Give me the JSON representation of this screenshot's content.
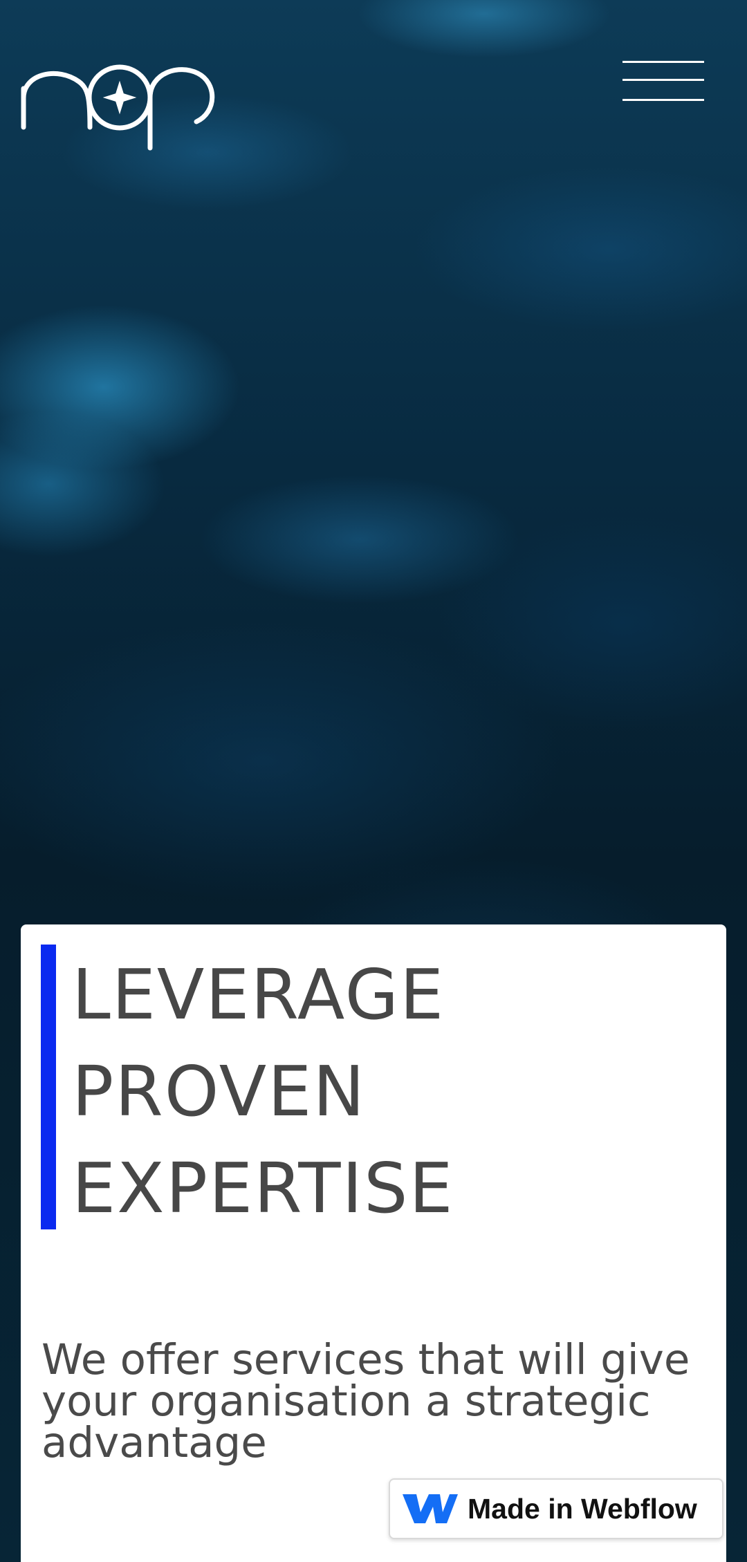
{
  "header": {
    "logo_icon": "nsp-logo-icon",
    "menu_icon": "hamburger-menu-icon"
  },
  "hero": {
    "headline": [
      "LEVERAGE",
      "PROVEN",
      "EXPERTISE"
    ],
    "subtitle": "We offer services that will give your organisation a strategic advantage",
    "accent_color": "#0a2af0"
  },
  "badge": {
    "label": "Made in Webflow",
    "icon": "webflow-logo-icon",
    "icon_color": "#146ef5"
  }
}
